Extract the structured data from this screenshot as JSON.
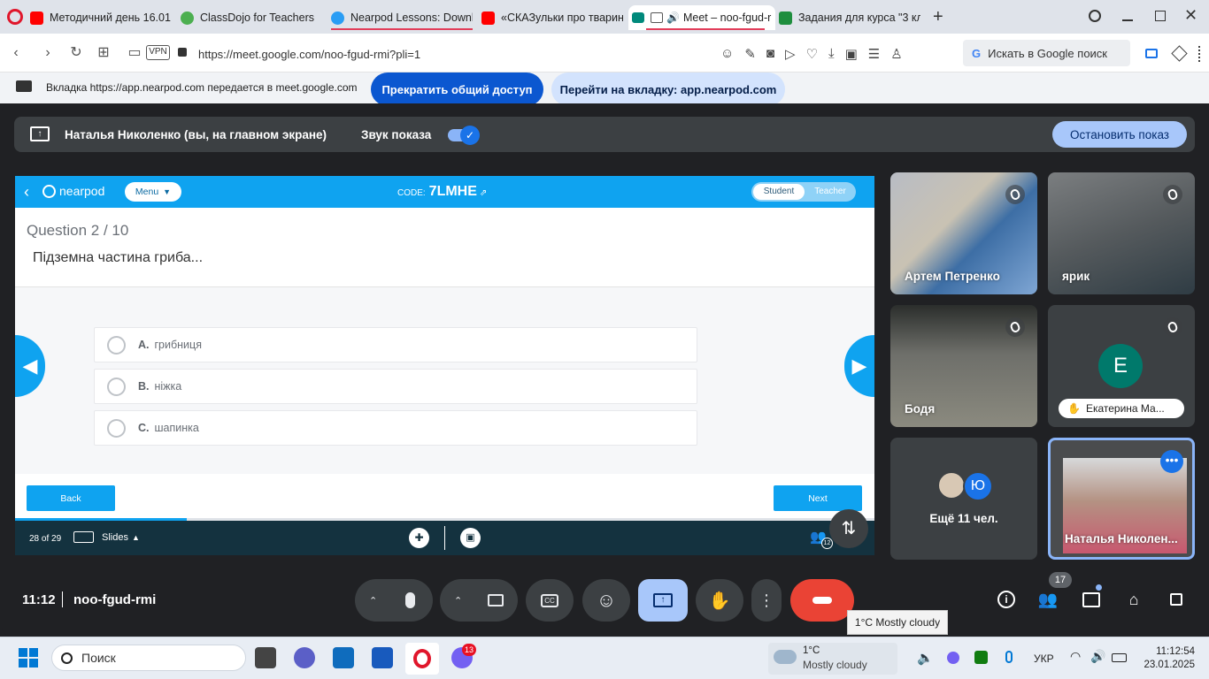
{
  "browser": {
    "tabs": [
      {
        "title": "Методичний день 16.01",
        "icon": "youtube-icon",
        "color": "#ff0000"
      },
      {
        "title": "ClassDojo for Teachers",
        "icon": "classdojo-icon",
        "color": "#5b5"
      },
      {
        "title": "Nearpod Lessons: Downlo",
        "icon": "nearpod-icon",
        "color": "#2a9df4"
      },
      {
        "title": "«СКАЗульки про тварин»",
        "icon": "youtube-icon",
        "color": "#ff0000"
      },
      {
        "title": "Meet – noo-fgud-r",
        "icon": "meet-icon",
        "color": "#00897b",
        "active": true
      },
      {
        "title": "Задания для курса \"3 кла",
        "icon": "classroom-icon",
        "color": "#1e8e3e"
      }
    ],
    "vpn_label": "VPN",
    "url": "https://meet.google.com/noo-fgud-rmi?pli=1",
    "search_placeholder": "Искать в Google поиск"
  },
  "share_banner": {
    "text": "Вкладка https://app.nearpod.com передается в meet.google.com",
    "stop_button": "Прекратить общий доступ",
    "switch_button": "Перейти на вкладку: app.nearpod.com"
  },
  "presentation_bar": {
    "presenter": "Наталья Николенко (вы, на главном экране)",
    "audio_label": "Звук показа",
    "audio_on": true,
    "stop_button": "Остановить показ"
  },
  "nearpod": {
    "logo": "nearpod",
    "menu_label": "Menu",
    "code_label": "CODE:",
    "code": "7LMHE",
    "mode_student": "Student",
    "mode_teacher": "Teacher",
    "question_header": "Question 2 / 10",
    "question_text": "Підземна частина гриба...",
    "options": [
      {
        "letter": "A.",
        "text": "грибниця"
      },
      {
        "letter": "B.",
        "text": "ніжка"
      },
      {
        "letter": "C.",
        "text": "шапинка"
      }
    ],
    "back_button": "Back",
    "next_button": "Next",
    "progress_fraction": 0.2,
    "slide_counter": "28 of 29",
    "slides_label": "Slides",
    "participants_count": "12"
  },
  "participants": [
    {
      "name": "Артем Петренко",
      "muted": true
    },
    {
      "name": "ярик",
      "muted": true
    },
    {
      "name": "Бодя",
      "muted": true
    },
    {
      "name": "Екатерина Ма...",
      "initial": "E",
      "muted": true,
      "color": "#00796b"
    },
    {
      "more_label": "Ещё 11 чел.",
      "initial": "Ю",
      "color": "#1a73e8"
    },
    {
      "name": "Наталья Николен...",
      "self": true
    }
  ],
  "controls": {
    "time": "11:12",
    "meeting_code": "noo-fgud-rmi",
    "people_badge": "17",
    "weather_tooltip": "1°C Mostly cloudy"
  },
  "taskbar": {
    "search_label": "Поиск",
    "weather_temp": "1°C",
    "weather_text": "Mostly cloudy",
    "viber_badge": "13",
    "language": "УКР",
    "time": "11:12:54",
    "date": "23.01.2025"
  }
}
